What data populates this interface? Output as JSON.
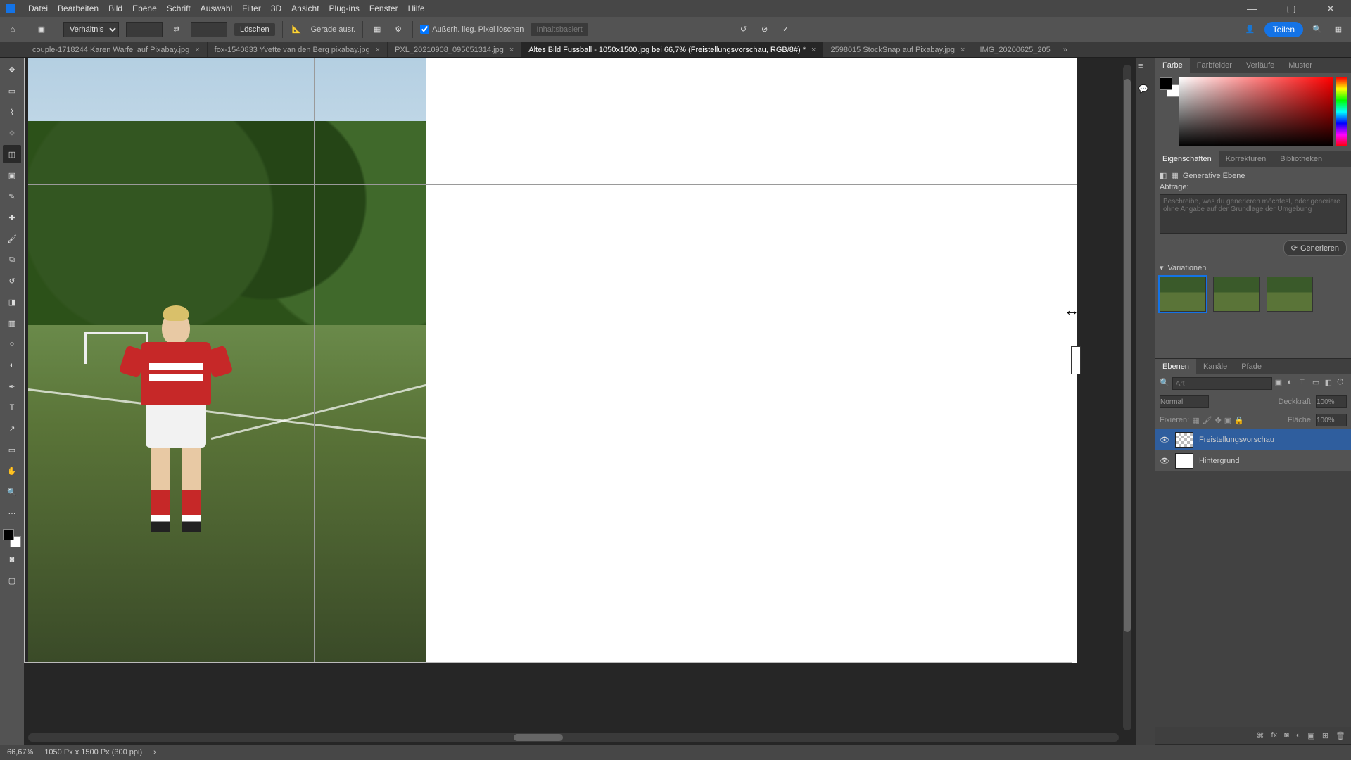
{
  "menu": [
    "Datei",
    "Bearbeiten",
    "Bild",
    "Ebene",
    "Schrift",
    "Auswahl",
    "Filter",
    "3D",
    "Ansicht",
    "Plug-ins",
    "Fenster",
    "Hilfe"
  ],
  "options": {
    "ratio_label": "Verhältnis",
    "clear": "Löschen",
    "straighten": "Gerade ausr.",
    "delete_cropped": "Außerh. lieg. Pixel löschen",
    "content_aware": "Inhaltsbasiert",
    "share": "Teilen"
  },
  "tabs": [
    {
      "label": "couple-1718244 Karen Warfel auf Pixabay.jpg",
      "active": false
    },
    {
      "label": "fox-1540833 Yvette van den Berg pixabay.jpg",
      "active": false
    },
    {
      "label": "PXL_20210908_095051314.jpg",
      "active": false
    },
    {
      "label": "Altes Bild Fussball - 1050x1500.jpg bei 66,7% (Freistellungsvorschau, RGB/8#) *",
      "active": true
    },
    {
      "label": "2598015 StockSnap auf Pixabay.jpg",
      "active": false
    },
    {
      "label": "IMG_20200625_205",
      "active": false
    }
  ],
  "panels": {
    "color_tabs": [
      "Farbe",
      "Farbfelder",
      "Verläufe",
      "Muster"
    ],
    "props_tabs": [
      "Eigenschaften",
      "Korrekturen",
      "Bibliotheken"
    ],
    "layers_tabs": [
      "Ebenen",
      "Kanäle",
      "Pfade"
    ]
  },
  "properties": {
    "type": "Generative Ebene",
    "prompt_label": "Abfrage:",
    "prompt_placeholder": "Beschreibe, was du generieren möchtest, oder generiere ohne Angabe auf der Grundlage der Umgebung",
    "generate": "Generieren",
    "variations": "Variationen"
  },
  "layers": {
    "search_placeholder": "Art",
    "blend": "Normal",
    "opacity_label": "Deckkraft:",
    "opacity_val": "100%",
    "lock_label": "Fixieren:",
    "fill_label": "Fläche:",
    "fill_val": "100%",
    "rows": [
      {
        "name": "Freistellungsvorschau",
        "sel": true,
        "checker": true
      },
      {
        "name": "Hintergrund",
        "sel": false,
        "checker": false
      }
    ]
  },
  "status": {
    "zoom": "66,67%",
    "docinfo": "1050 Px x 1500 Px (300 ppi)"
  }
}
